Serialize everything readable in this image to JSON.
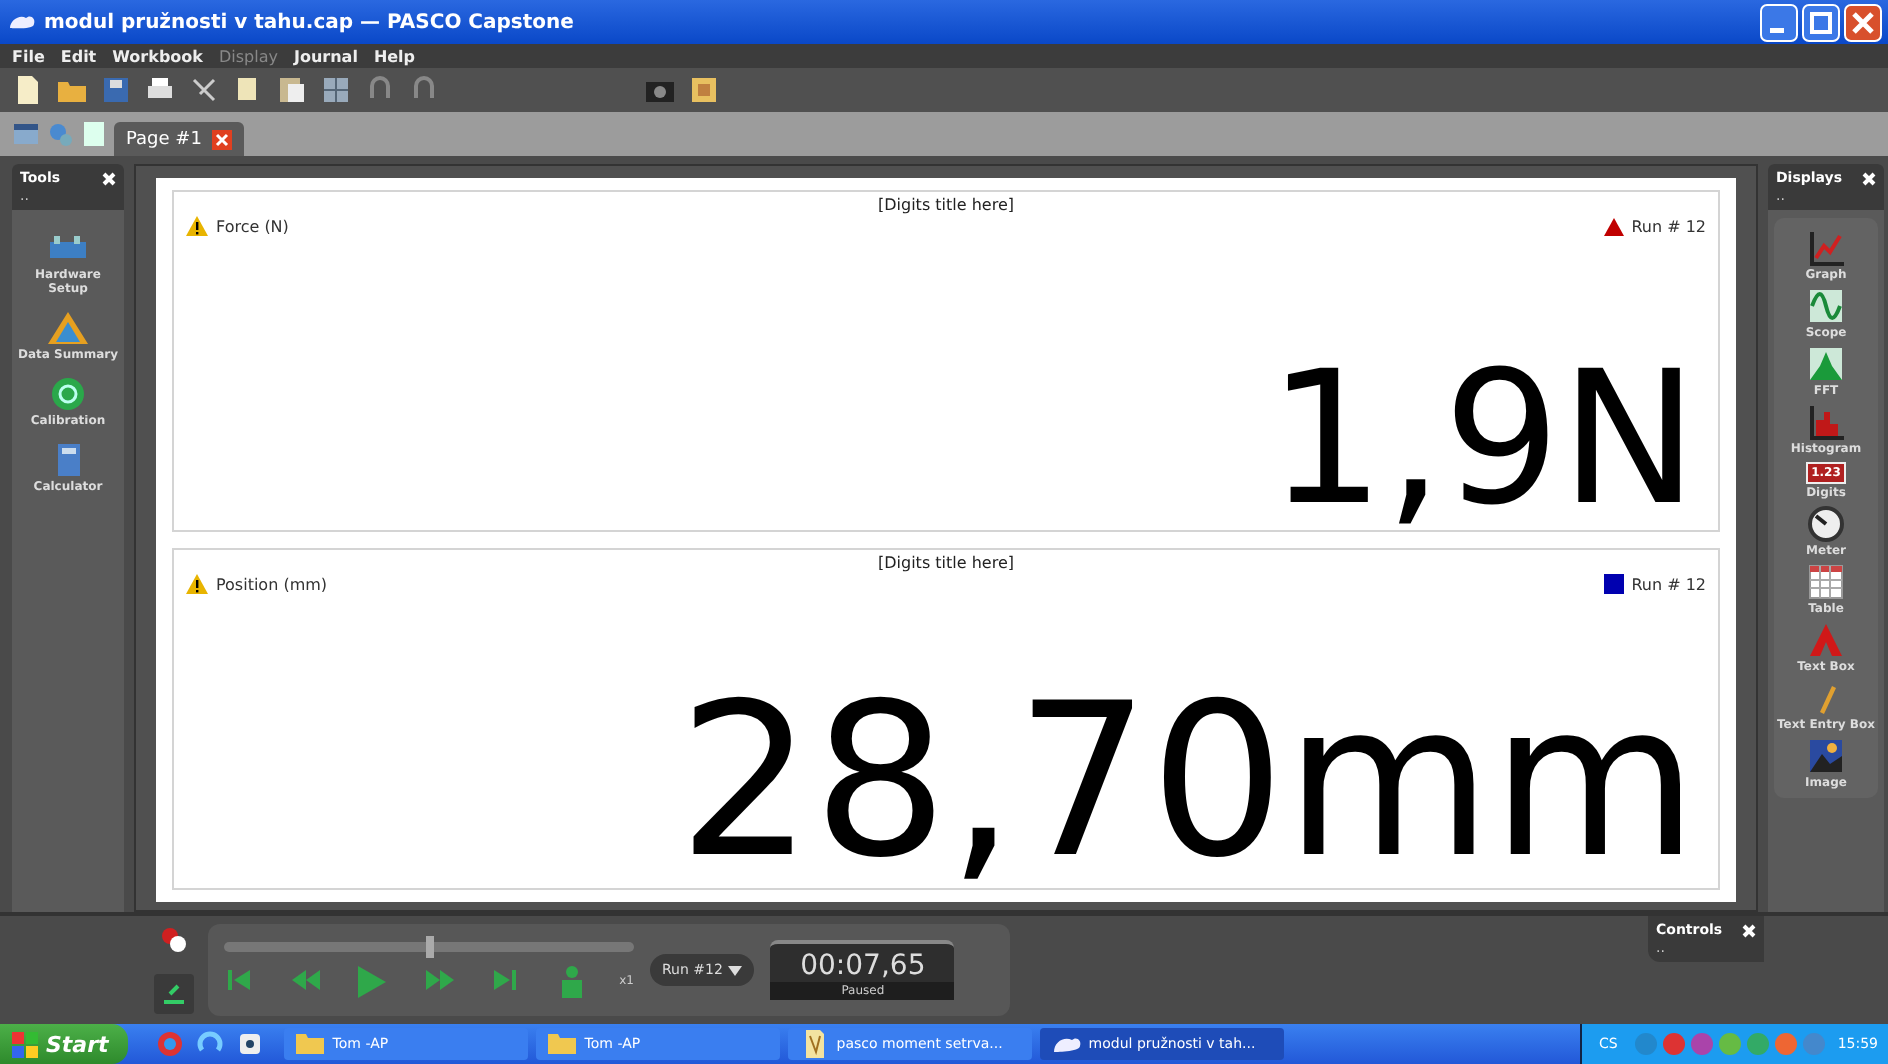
{
  "window": {
    "title": "modul pružnosti v tahu.cap — PASCO Capstone"
  },
  "menu": [
    {
      "label": "File",
      "disabled": false
    },
    {
      "label": "Edit",
      "disabled": false
    },
    {
      "label": "Workbook",
      "disabled": false
    },
    {
      "label": "Display",
      "disabled": true
    },
    {
      "label": "Journal",
      "disabled": false
    },
    {
      "label": "Help",
      "disabled": false
    }
  ],
  "tabs": [
    {
      "label": "Page #1",
      "selected": true
    }
  ],
  "tools_panel": {
    "title": "Tools",
    "grip": "..",
    "items": [
      {
        "label": "Hardware Setup",
        "kind": "hardware"
      },
      {
        "label": "Data Summary",
        "kind": "summary"
      },
      {
        "label": "Calibration",
        "kind": "calibration"
      },
      {
        "label": "Calculator",
        "kind": "calculator"
      }
    ]
  },
  "digits": [
    {
      "title": "[Digits title here]",
      "measurement": "Force (N)",
      "run": "Run # 12",
      "kind": "triangle",
      "color": "#c00000",
      "value": "1,9N"
    },
    {
      "title": "[Digits title here]",
      "measurement": "Position (mm)",
      "run": "Run # 12",
      "kind": "square",
      "color": "#0000b0",
      "value": "28,70mm"
    }
  ],
  "displays_panel": {
    "title": "Displays",
    "grip": "..",
    "items": [
      {
        "label": "Graph",
        "kind": "graph"
      },
      {
        "label": "Scope",
        "kind": "scope"
      },
      {
        "label": "FFT",
        "kind": "fft"
      },
      {
        "label": "Histogram",
        "kind": "histogram"
      },
      {
        "label": "Digits",
        "kind": "digits",
        "badge": "1.23"
      },
      {
        "label": "Meter",
        "kind": "meter"
      },
      {
        "label": "Table",
        "kind": "table"
      },
      {
        "label": "Text Box",
        "kind": "textbox"
      },
      {
        "label": "Text Entry Box",
        "kind": "textentry"
      },
      {
        "label": "Image",
        "kind": "image"
      }
    ]
  },
  "controls": {
    "playback": {
      "level": 0.5
    },
    "rate": "x1",
    "run_select": "Run #12",
    "time": "00:07,65",
    "status": "Paused",
    "panel_title": "Controls",
    "grip": ".."
  },
  "taskbar": {
    "start": "Start",
    "tasks": [
      {
        "label": "Tom -AP",
        "kind": "folder",
        "selected": false
      },
      {
        "label": "Tom -AP",
        "kind": "folder",
        "selected": false
      },
      {
        "label": "pasco moment setrva...",
        "kind": "document",
        "selected": false
      },
      {
        "label": "modul pružnosti v tah...",
        "kind": "capstone",
        "selected": true
      }
    ],
    "language": "CS",
    "clock": "15:59"
  }
}
